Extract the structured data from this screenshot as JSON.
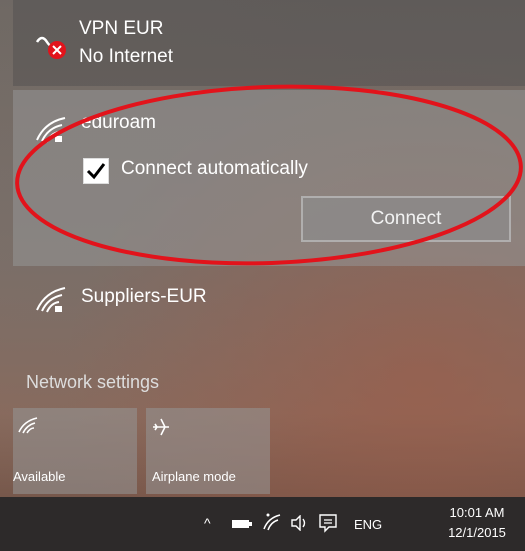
{
  "vpn": {
    "name": "VPN EUR",
    "status": "No Internet",
    "icon": "vpn-disconnected-icon"
  },
  "networks": [
    {
      "name": "eduroam",
      "icon": "wifi-secured-icon",
      "connect_auto_label": "Connect automatically",
      "connect_auto_checked": true,
      "connect_button": "Connect"
    },
    {
      "name": "Suppliers-EUR",
      "icon": "wifi-secured-icon"
    }
  ],
  "network_settings": "Network settings",
  "quick_actions": [
    {
      "label": "Available",
      "icon": "wifi-icon"
    },
    {
      "label": "Airplane mode",
      "icon": "airplane-icon"
    }
  ],
  "taskbar": {
    "chevron": "^",
    "language": "ENG",
    "time": "10:01 AM",
    "date": "12/1/2015"
  },
  "annotation": {
    "color": "#e2131b"
  }
}
